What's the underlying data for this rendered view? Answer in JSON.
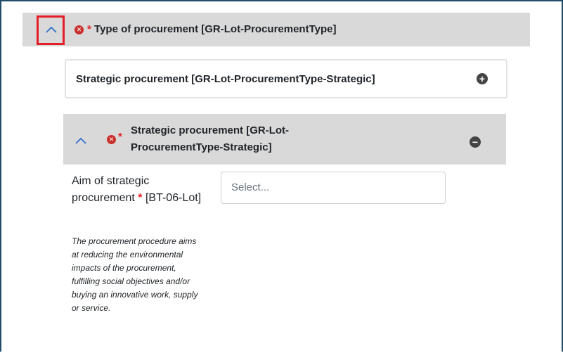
{
  "section": {
    "title": "Type of procurement  [GR-Lot-ProcurementType]",
    "required_marker": "*",
    "error_icon": "times-circle-icon",
    "toggle_icon": "chevron-up-icon",
    "highlight_color": "#e41e26"
  },
  "subsection_card": {
    "label": "Strategic procurement  [GR-Lot-ProcurementType-Strategic]",
    "add_icon": "plus-circle-icon"
  },
  "inner_section": {
    "title_line1": "Strategic procurement  [GR-Lot-",
    "title_line2": "ProcurementType-Strategic]",
    "required_marker": "*",
    "remove_icon": "minus-circle-icon"
  },
  "field": {
    "label_part1": "Aim of strategic procurement",
    "required_marker": "*",
    "label_part2": "[BT-06-Lot]",
    "help_text": "The procurement procedure aims at reducing the environmental impacts of the procurement, fulfilling social objectives and/or buying an innovative work, supply or service.",
    "select_placeholder": "Select..."
  }
}
